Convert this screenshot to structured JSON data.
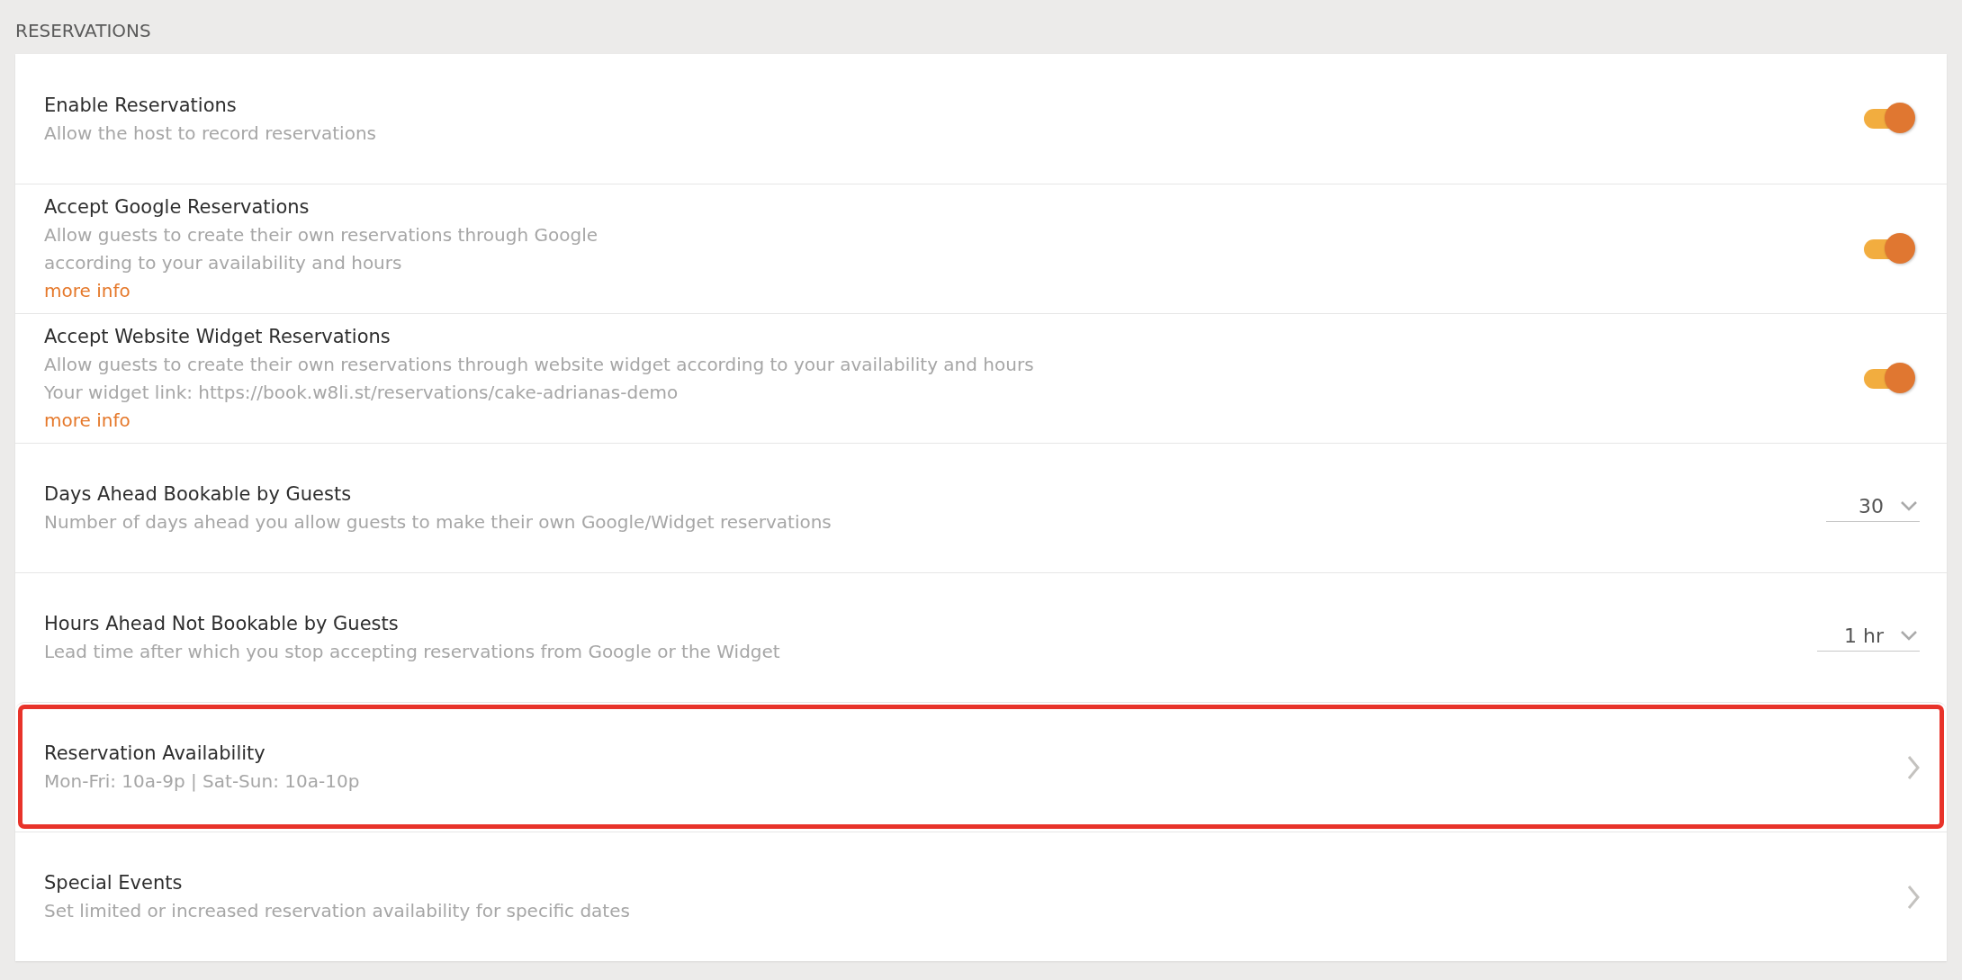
{
  "section_title": "RESERVATIONS",
  "rows": [
    {
      "kind": "toggle",
      "title": "Enable Reservations",
      "lines": [
        "Allow the host to record reservations"
      ],
      "on": true,
      "highlighted": false
    },
    {
      "kind": "toggle",
      "title": "Accept Google Reservations",
      "lines": [
        "Allow guests to create their own reservations through Google",
        "according to your availability and hours"
      ],
      "link": "more info",
      "on": true,
      "highlighted": false
    },
    {
      "kind": "toggle",
      "title": "Accept Website Widget Reservations",
      "lines": [
        "Allow guests to create their own reservations through website widget according to your availability and hours",
        "Your widget link: https://book.w8li.st/reservations/cake-adrianas-demo"
      ],
      "link": "more info",
      "on": true,
      "highlighted": false
    },
    {
      "kind": "select",
      "title": "Days Ahead Bookable by Guests",
      "lines": [
        "Number of days ahead you allow guests to make their own Google/Widget reservations"
      ],
      "value": "30",
      "highlighted": false
    },
    {
      "kind": "select",
      "title": "Hours Ahead Not Bookable by Guests",
      "lines": [
        "Lead time after which you stop accepting reservations from Google or the Widget"
      ],
      "value": "1 hr",
      "highlighted": false
    },
    {
      "kind": "nav",
      "title": "Reservation Availability",
      "lines": [
        "Mon-Fri: 10a-9p | Sat-Sun: 10a-10p"
      ],
      "highlighted": true
    },
    {
      "kind": "nav",
      "title": "Special Events",
      "lines": [
        "Set limited or increased reservation availability for specific dates"
      ],
      "highlighted": false
    }
  ]
}
